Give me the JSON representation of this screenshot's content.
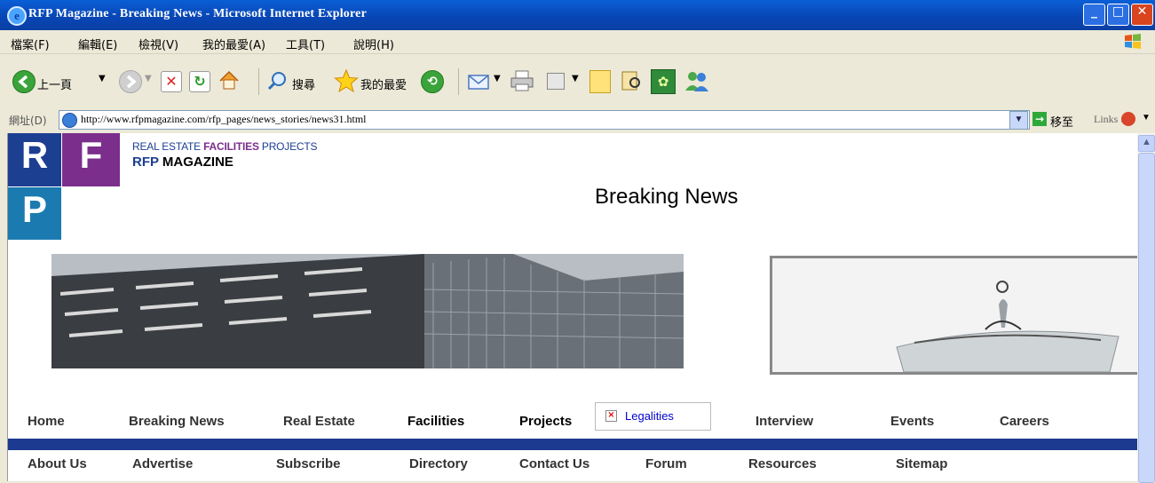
{
  "window": {
    "title": "RFP Magazine - Breaking News - Microsoft Internet Explorer",
    "buttons": [
      "minimize",
      "maximize",
      "close"
    ]
  },
  "menu": [
    "檔案(F)",
    "編輯(E)",
    "檢視(V)",
    "我的最愛(A)",
    "工具(T)",
    "說明(H)"
  ],
  "toolbar": {
    "back_label": "上一頁",
    "search_label": "搜尋",
    "favorites_label": "我的最愛"
  },
  "address": {
    "label": "網址(D)",
    "url": "http://www.rfpmagazine.com/rfp_pages/news_stories/news31.html",
    "go_label": "移至",
    "links_label": "Links"
  },
  "logo": {
    "letters": [
      "R",
      "F",
      "P"
    ],
    "colors": {
      "blue": "#1d3f92",
      "purple": "#7b2e8c",
      "teal": "#1b7bb0"
    }
  },
  "tagline": {
    "line1_a": "REAL ESTATE",
    "line1_b": "FACILITIES",
    "line1_c": "PROJECTS",
    "line2_a": "RFP",
    "line2_b": "MAGAZINE"
  },
  "page_heading": "Breaking News",
  "nav_primary": [
    "Home",
    "Breaking News",
    "Real Estate",
    "Facilities",
    "Projects",
    "Legalities",
    "Interview",
    "Events",
    "Careers"
  ],
  "nav_secondary": [
    "About Us",
    "Advertise",
    "Subscribe",
    "Directory",
    "Contact Us",
    "Forum",
    "Resources",
    "Sitemap"
  ],
  "colors": {
    "titlebar": "#0846b5",
    "nav_bar": "#1c3a8f",
    "link": "#0000cc"
  }
}
